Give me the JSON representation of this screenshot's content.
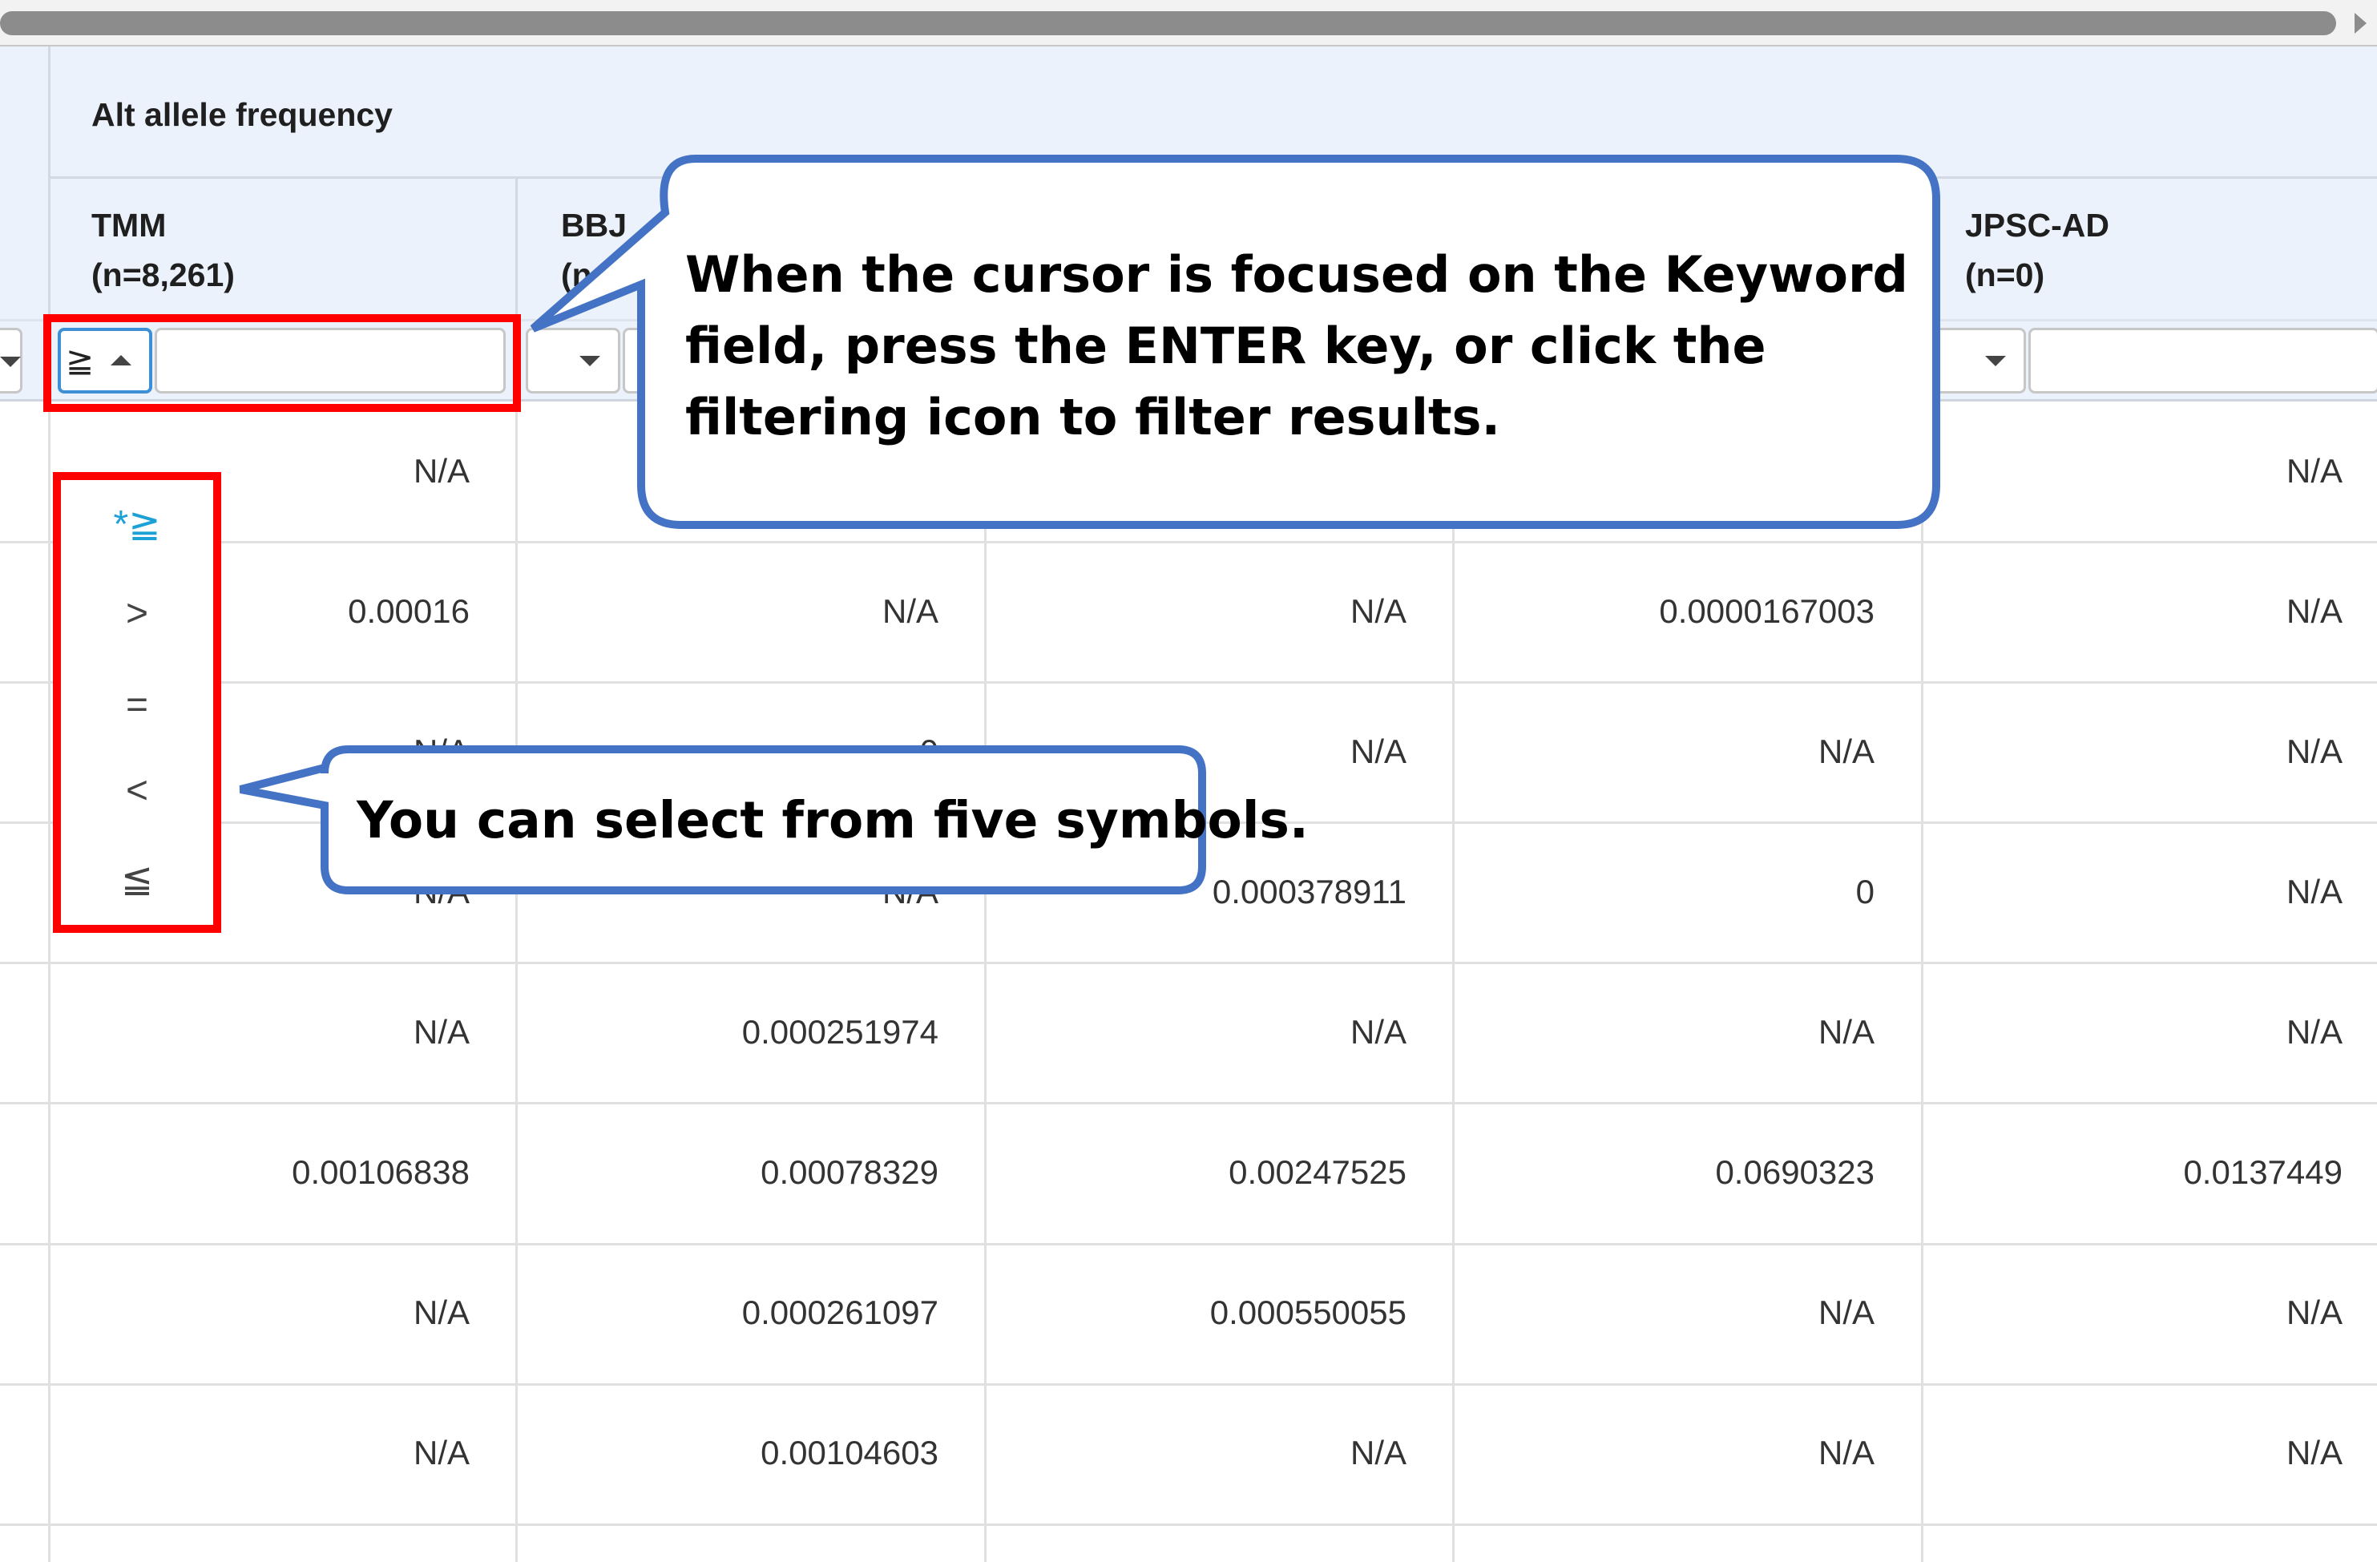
{
  "header": {
    "group_title": "Alt allele frequency",
    "columns": [
      {
        "name": "TMM",
        "n": "(n=8,261)"
      },
      {
        "name": "BBJ",
        "n": "(n"
      },
      {
        "name": "",
        "n": ""
      },
      {
        "name": "",
        "n": ""
      },
      {
        "name": "JPSC-AD",
        "n": "(n=0)"
      }
    ]
  },
  "filter": {
    "operator_value": "≧",
    "keyword_value": "",
    "operators": [
      "*≧",
      ">",
      "=",
      "<",
      "≦"
    ]
  },
  "rows": [
    [
      "N/A",
      "",
      "",
      "",
      "N/A"
    ],
    [
      "0.00016",
      "N/A",
      "N/A",
      "0.0000167003",
      "N/A"
    ],
    [
      "N/A",
      "0",
      "N/A",
      "N/A",
      "N/A"
    ],
    [
      "N/A",
      "N/A",
      "0.000378911",
      "0",
      "N/A"
    ],
    [
      "N/A",
      "0.000251974",
      "N/A",
      "N/A",
      "N/A"
    ],
    [
      "0.00106838",
      "0.00078329",
      "0.00247525",
      "0.0690323",
      "0.0137449"
    ],
    [
      "N/A",
      "0.000261097",
      "0.000550055",
      "N/A",
      "N/A"
    ],
    [
      "N/A",
      "0.00104603",
      "N/A",
      "N/A",
      "N/A"
    ]
  ],
  "callouts": {
    "keyword_tip": "When the cursor is focused on the Keyword field, press the ENTER key, or click the filtering icon to filter results.",
    "symbols_tip": "You can select from five symbols."
  },
  "colors": {
    "callout_border": "#4472c4",
    "highlight": "#ff0000",
    "header_bg": "#ebf2fb",
    "selected_option": "#1ba1d6"
  }
}
